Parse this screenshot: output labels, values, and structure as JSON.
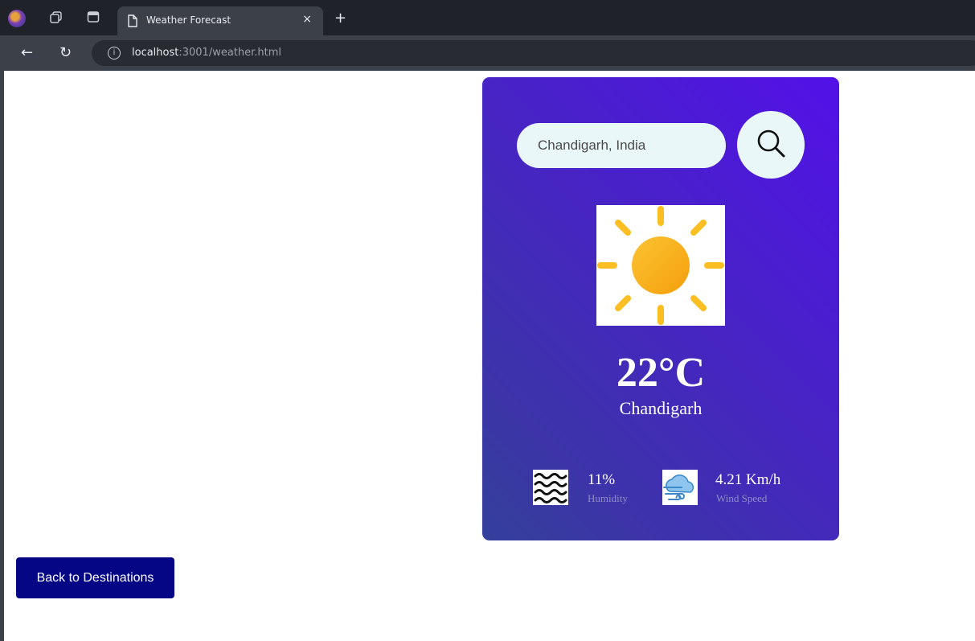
{
  "browser": {
    "tab_title": "Weather Forecast",
    "close_glyph": "×",
    "new_tab_glyph": "+",
    "back_glyph": "←",
    "reload_glyph": "↻",
    "info_glyph": "i",
    "url_host": "localhost",
    "url_rest": ":3001/weather.html"
  },
  "search": {
    "value": "Chandigarh, India",
    "icon": "search-icon"
  },
  "weather": {
    "icon": "sun-icon",
    "temperature": "22°C",
    "city": "Chandigarh",
    "humidity_value": "11%",
    "humidity_label": "Humidity",
    "humidity_icon": "humidity-waves-icon",
    "wind_value": "4.21 Km/h",
    "wind_label": "Wind Speed",
    "wind_icon": "wind-cloud-icon"
  },
  "colors": {
    "card_gradient_start": "#5211e8",
    "card_gradient_end": "#34409a",
    "sun_yellow": "#fbbf24",
    "back_button": "#040685"
  },
  "back_button": {
    "label": "Back to Destinations"
  }
}
